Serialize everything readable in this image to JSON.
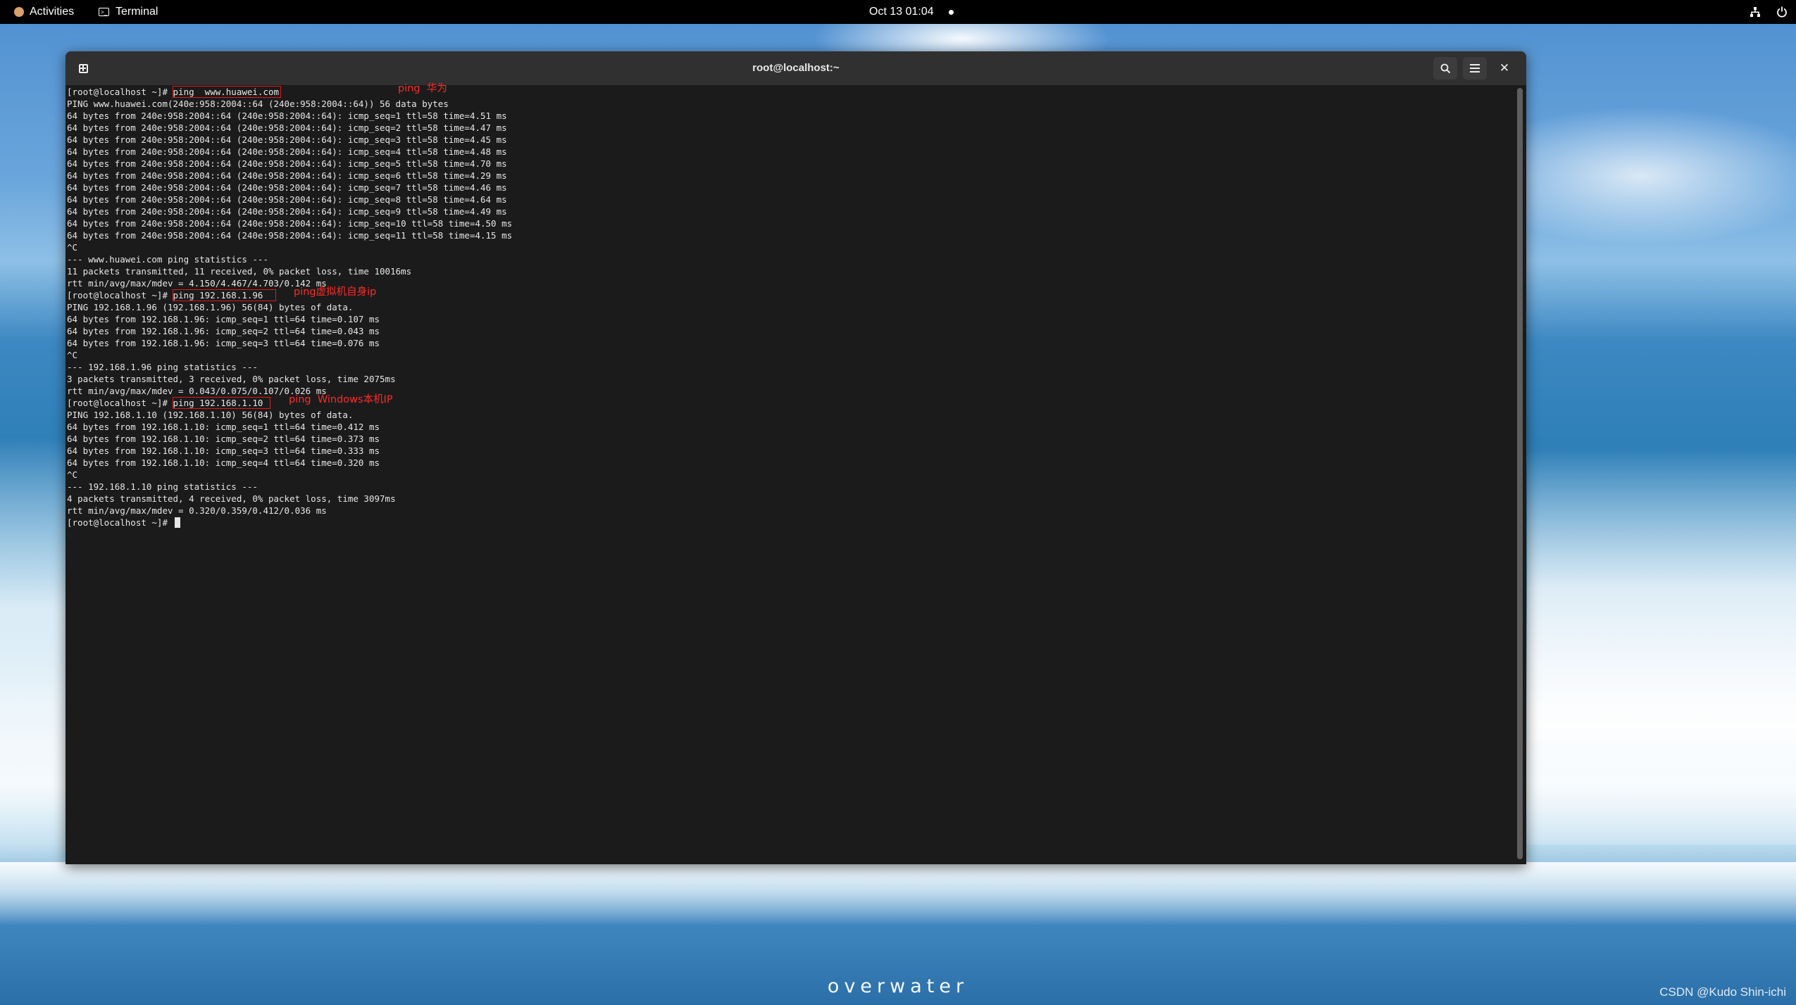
{
  "topbar": {
    "activities": "Activities",
    "app_name": "Terminal",
    "clock": "Oct 13  01:04",
    "icons": [
      "network-icon",
      "power-icon"
    ]
  },
  "window": {
    "title": "root@localhost:~",
    "buttons": [
      "new-tab",
      "search",
      "menu",
      "close"
    ]
  },
  "terminal": {
    "lines": [
      {
        "prompt": "[root@localhost ~]# ",
        "command": "ping  www.huawei.com",
        "annotation": "ping  华为"
      },
      {
        "text": "PING www.huawei.com(240e:958:2004::64 (240e:958:2004::64)) 56 data bytes"
      },
      {
        "text": "64 bytes from 240e:958:2004::64 (240e:958:2004::64): icmp_seq=1 ttl=58 time=4.51 ms"
      },
      {
        "text": "64 bytes from 240e:958:2004::64 (240e:958:2004::64): icmp_seq=2 ttl=58 time=4.47 ms"
      },
      {
        "text": "64 bytes from 240e:958:2004::64 (240e:958:2004::64): icmp_seq=3 ttl=58 time=4.45 ms"
      },
      {
        "text": "64 bytes from 240e:958:2004::64 (240e:958:2004::64): icmp_seq=4 ttl=58 time=4.48 ms"
      },
      {
        "text": "64 bytes from 240e:958:2004::64 (240e:958:2004::64): icmp_seq=5 ttl=58 time=4.70 ms"
      },
      {
        "text": "64 bytes from 240e:958:2004::64 (240e:958:2004::64): icmp_seq=6 ttl=58 time=4.29 ms"
      },
      {
        "text": "64 bytes from 240e:958:2004::64 (240e:958:2004::64): icmp_seq=7 ttl=58 time=4.46 ms"
      },
      {
        "text": "64 bytes from 240e:958:2004::64 (240e:958:2004::64): icmp_seq=8 ttl=58 time=4.64 ms"
      },
      {
        "text": "64 bytes from 240e:958:2004::64 (240e:958:2004::64): icmp_seq=9 ttl=58 time=4.49 ms"
      },
      {
        "text": "64 bytes from 240e:958:2004::64 (240e:958:2004::64): icmp_seq=10 ttl=58 time=4.50 ms"
      },
      {
        "text": "64 bytes from 240e:958:2004::64 (240e:958:2004::64): icmp_seq=11 ttl=58 time=4.15 ms"
      },
      {
        "text": "^C"
      },
      {
        "text": "--- www.huawei.com ping statistics ---"
      },
      {
        "text": "11 packets transmitted, 11 received, 0% packet loss, time 10016ms"
      },
      {
        "text": "rtt min/avg/max/mdev = 4.150/4.467/4.703/0.142 ms"
      },
      {
        "prompt": "[root@localhost ~]# ",
        "command": "ping 192.168.1.96  ",
        "annotation": "ping虚拟机自身ip"
      },
      {
        "text": "PING 192.168.1.96 (192.168.1.96) 56(84) bytes of data."
      },
      {
        "text": "64 bytes from 192.168.1.96: icmp_seq=1 ttl=64 time=0.107 ms"
      },
      {
        "text": "64 bytes from 192.168.1.96: icmp_seq=2 ttl=64 time=0.043 ms"
      },
      {
        "text": "64 bytes from 192.168.1.96: icmp_seq=3 ttl=64 time=0.076 ms"
      },
      {
        "text": "^C"
      },
      {
        "text": "--- 192.168.1.96 ping statistics ---"
      },
      {
        "text": "3 packets transmitted, 3 received, 0% packet loss, time 2075ms"
      },
      {
        "text": "rtt min/avg/max/mdev = 0.043/0.075/0.107/0.026 ms"
      },
      {
        "prompt": "[root@localhost ~]# ",
        "command": "ping 192.168.1.10 ",
        "annotation": "ping  Windows本机IP"
      },
      {
        "text": "PING 192.168.1.10 (192.168.1.10) 56(84) bytes of data."
      },
      {
        "text": "64 bytes from 192.168.1.10: icmp_seq=1 ttl=64 time=0.412 ms"
      },
      {
        "text": "64 bytes from 192.168.1.10: icmp_seq=2 ttl=64 time=0.373 ms"
      },
      {
        "text": "64 bytes from 192.168.1.10: icmp_seq=3 ttl=64 time=0.333 ms"
      },
      {
        "text": "64 bytes from 192.168.1.10: icmp_seq=4 ttl=64 time=0.320 ms"
      },
      {
        "text": "^C"
      },
      {
        "text": "--- 192.168.1.10 ping statistics ---"
      },
      {
        "text": "4 packets transmitted, 4 received, 0% packet loss, time 3097ms"
      },
      {
        "text": "rtt min/avg/max/mdev = 0.320/0.359/0.412/0.036 ms"
      },
      {
        "prompt": "[root@localhost ~]# ",
        "cursor": true
      }
    ]
  },
  "wallpaper": {
    "caption": "overwater",
    "watermark": "CSDN @Kudo Shin-ichi"
  },
  "colors": {
    "annotation": "#ff2a2a",
    "terminal_bg": "#1b1b1b",
    "terminal_fg": "#e6e6e6"
  }
}
